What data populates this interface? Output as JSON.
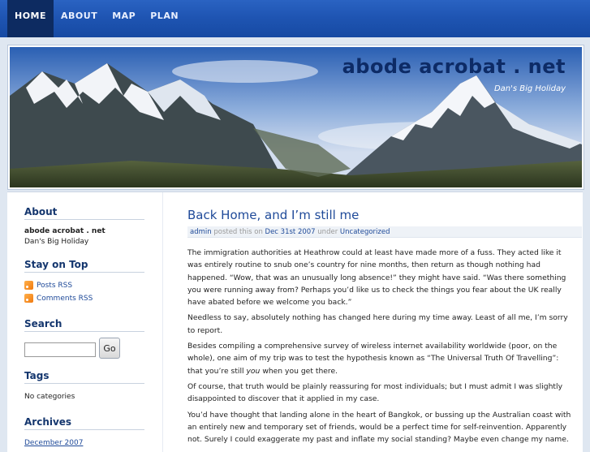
{
  "nav": {
    "items": [
      {
        "label": "HOME",
        "active": true
      },
      {
        "label": "ABOUT",
        "active": false
      },
      {
        "label": "MAP",
        "active": false
      },
      {
        "label": "PLAN",
        "active": false
      }
    ]
  },
  "header": {
    "site_title": "abode acrobat . net",
    "tagline": "Dan's Big Holiday"
  },
  "sidebar": {
    "about_title": "About",
    "about_name": "abode acrobat . net",
    "about_tagline": "Dan's Big Holiday",
    "stay_title": "Stay on Top",
    "posts_rss": "Posts RSS",
    "comments_rss": "Comments RSS",
    "search_title": "Search",
    "search_button": "Go",
    "search_value": "",
    "tags_title": "Tags",
    "tags_text": "No categories",
    "archives_title": "Archives",
    "archive_first": "December 2007"
  },
  "post": {
    "title": "Back Home, and I’m still me",
    "meta": {
      "author": "admin",
      "posted_text": "posted this on",
      "date": "Dec 31st 2007",
      "under_text": "under",
      "category": "Uncategorized"
    },
    "paragraphs": [
      "The immigration authorities at Heathrow could at least have made more of a fuss. They acted like it was entirely routine to snub one’s country for nine months, then return as though nothing had happened. “Wow, that was an unusually long absence!” they might have said. “Was there something you were running away from? Perhaps you’d like us to check the things you fear about the UK really have abated before we welcome you back.”",
      "Needless to say, absolutely nothing has changed here during my time away. Least of all me, I’m sorry to report.",
      "Of course, that truth would be plainly reassuring for most individuals; but I must admit I was slightly disappointed to discover that it applied in my case.",
      "You’d have thought that landing alone in the heart of Bangkok, or bussing up the Australian coast with an entirely new and temporary set of friends, would be a perfect time for self-reinvention. Apparently not. Surely I could exaggerate my past and inflate my social standing? Maybe even change my name."
    ],
    "p3_before": "Besides compiling a comprehensive survey of wireless internet availability worldwide (poor, on the whole), one aim of my trip was to test the hypothesis known as “The Universal Truth Of Travelling”: that you’re still",
    "p3_em": "you",
    "p3_after": "when you get there."
  },
  "colors": {
    "nav_bar": "#1f55b3",
    "nav_active": "#0d2b61",
    "link": "#1f4a99",
    "widget_title": "#14366e",
    "page_bg": "#dfe7f1"
  }
}
